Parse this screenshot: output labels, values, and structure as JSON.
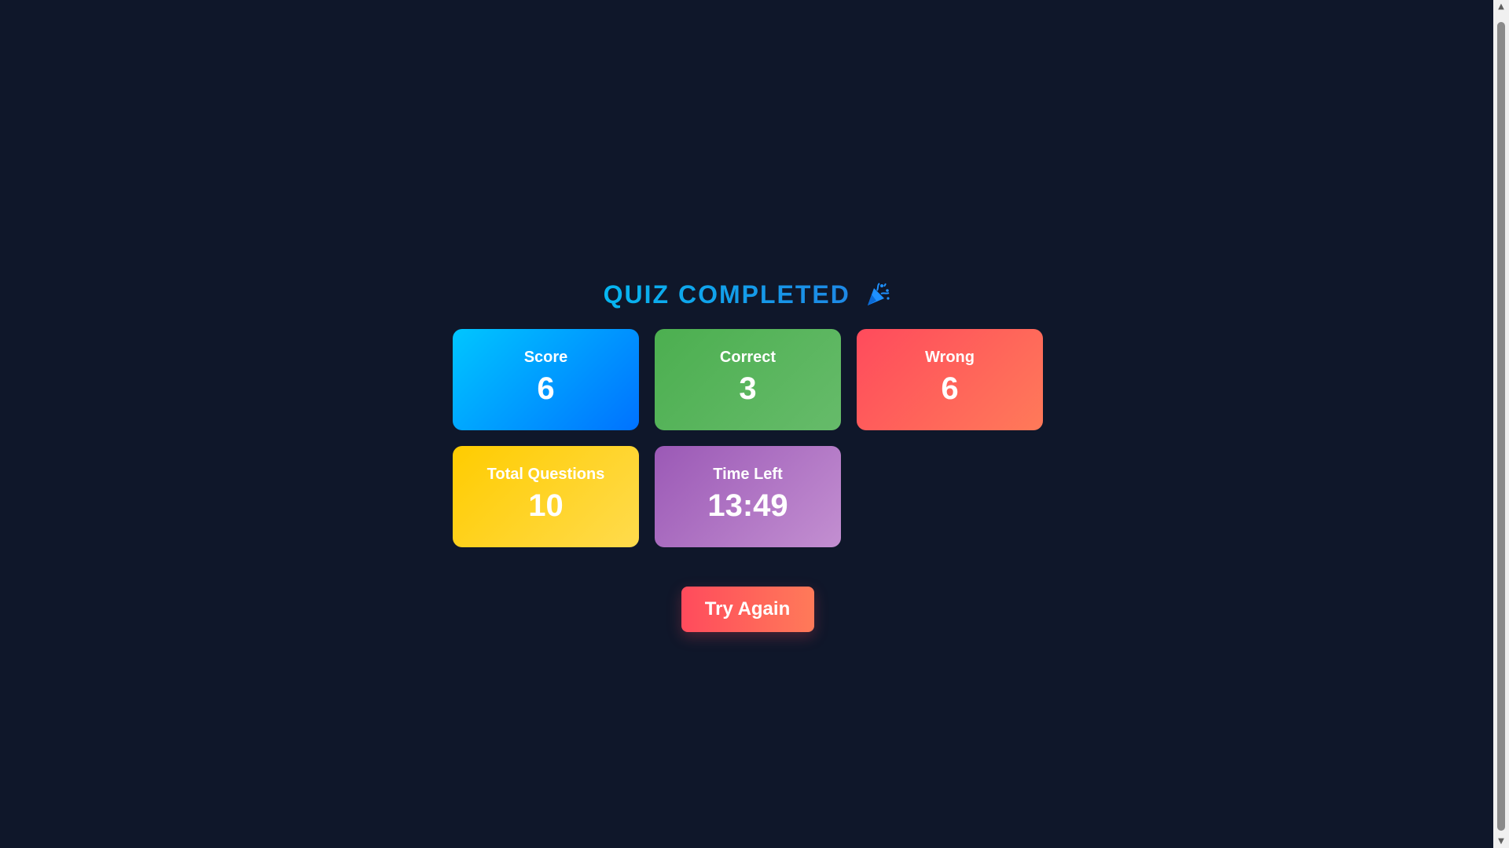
{
  "header": {
    "title": "QUIZ COMPLETED",
    "icon": "party-popper-icon",
    "accent_color": "#0ea5e9"
  },
  "stats": [
    {
      "label": "Score",
      "value": "6",
      "color": "#0072ff"
    },
    {
      "label": "Correct",
      "value": "3",
      "color": "#4caf50"
    },
    {
      "label": "Wrong",
      "value": "6",
      "color": "#ff4b5c"
    },
    {
      "label": "Total Questions",
      "value": "10",
      "color": "#ffcc00"
    },
    {
      "label": "Time Left",
      "value": "13:49",
      "color": "#9b59b6"
    }
  ],
  "actions": {
    "try_again_label": "Try Again"
  }
}
